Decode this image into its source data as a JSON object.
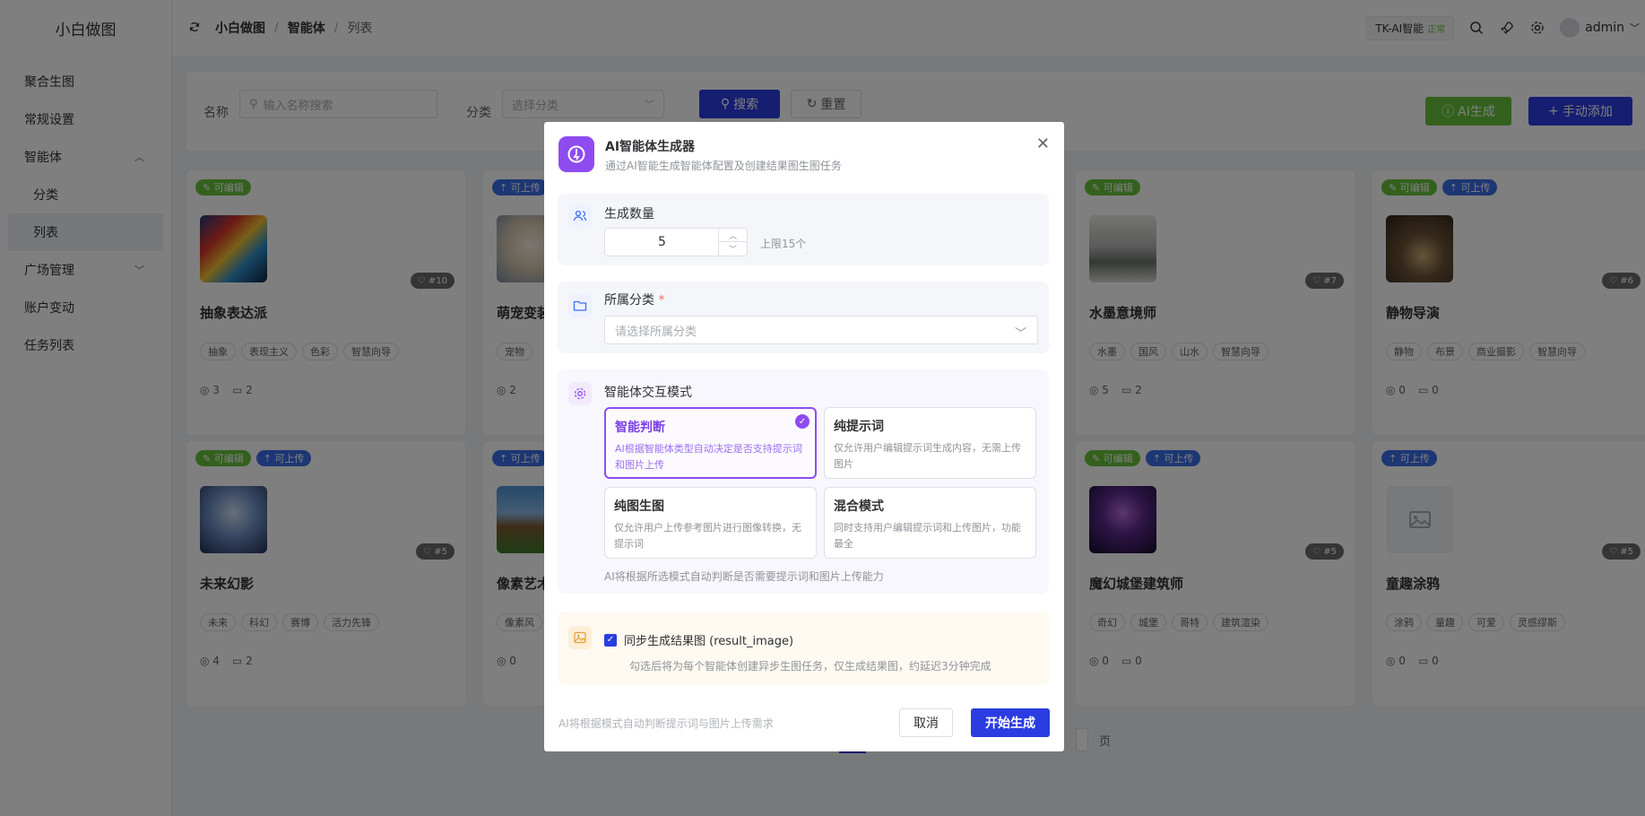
{
  "app": {
    "logo": "小白做图"
  },
  "sidebar": {
    "items": [
      {
        "label": "聚合生图"
      },
      {
        "label": "常规设置"
      },
      {
        "label": "智能体"
      },
      {
        "label": "分类"
      },
      {
        "label": "列表"
      },
      {
        "label": "广场管理"
      },
      {
        "label": "账户变动"
      },
      {
        "label": "任务列表"
      }
    ]
  },
  "header": {
    "breadcrumb": [
      "小白做图",
      "智能体",
      "列表"
    ],
    "badge_name": "TK-AI智能",
    "badge_status": "正常",
    "user": "admin"
  },
  "search": {
    "name_label": "名称",
    "name_placeholder": "输入名称搜索",
    "category_label": "分类",
    "category_placeholder": "选择分类",
    "search_btn": "搜索",
    "reset_btn": "重置",
    "ai_btn": "AI生成",
    "add_btn": "手动添加"
  },
  "cards": [
    {
      "editable": "可编辑",
      "title": "抽象表达派",
      "rank": "#10",
      "tags": [
        "抽象",
        "表现主义",
        "色彩",
        "智慧向导"
      ],
      "views": "3",
      "comments": "2",
      "thumb": "abstract"
    },
    {
      "upload": "可上传",
      "title": "萌宠变装",
      "rank": "",
      "tags": [
        "宠物"
      ],
      "views": "2",
      "comments": "",
      "thumb": "dog"
    },
    {
      "editable": "可编辑",
      "title": "水墨意境师",
      "rank": "#7",
      "tags": [
        "水墨",
        "国风",
        "山水",
        "智慧向导"
      ],
      "views": "5",
      "comments": "2",
      "thumb": "ink"
    },
    {
      "editable": "可编辑",
      "upload": "可上传",
      "title": "静物导演",
      "rank": "#6",
      "tags": [
        "静物",
        "布景",
        "商业摄影",
        "智慧向导"
      ],
      "views": "0",
      "comments": "0",
      "thumb": "still"
    },
    {
      "editable": "可编辑",
      "upload": "可上传",
      "title": "未来幻影",
      "rank": "#5",
      "tags": [
        "未来",
        "科幻",
        "赛博",
        "活力先锋"
      ],
      "views": "4",
      "comments": "2",
      "thumb": "future"
    },
    {
      "upload": "可上传",
      "title": "像素艺术",
      "rank": "",
      "tags": [
        "像素风"
      ],
      "views": "0",
      "comments": "",
      "thumb": "pixel"
    },
    {
      "editable": "可编辑",
      "upload": "可上传",
      "title": "魔幻城堡建筑师",
      "rank": "#5",
      "tags": [
        "奇幻",
        "城堡",
        "哥特",
        "建筑渲染"
      ],
      "views": "0",
      "comments": "0",
      "thumb": "castle"
    },
    {
      "upload": "可上传",
      "title": "童趣涂鸦",
      "rank": "#5",
      "tags": [
        "涂鸦",
        "童趣",
        "可爱",
        "灵感缪斯"
      ],
      "views": "0",
      "comments": "0",
      "thumb": "placeholder"
    }
  ],
  "pagination": {
    "suffix": "页"
  },
  "modal": {
    "title": "AI智能体生成器",
    "subtitle": "通过AI智能生成智能体配置及创建结果图生图任务",
    "count_label": "生成数量",
    "count_value": "5",
    "count_limit": "上限15个",
    "category_label": "所属分类",
    "category_required": "*",
    "category_placeholder": "请选择所属分类",
    "mode_label": "智能体交互模式",
    "modes": [
      {
        "title": "智能判断",
        "desc": "AI根据智能体类型自动决定是否支持提示词和图片上传",
        "selected": true
      },
      {
        "title": "纯提示词",
        "desc": "仅允许用户编辑提示词生成内容，无需上传图片",
        "selected": false
      },
      {
        "title": "纯图生图",
        "desc": "仅允许用户上传参考图片进行图像转换，无提示词",
        "selected": false
      },
      {
        "title": "混合模式",
        "desc": "同时支持用户编辑提示词和上传图片，功能最全",
        "selected": false
      }
    ],
    "mode_note": "AI将根据所选模式自动判断是否需要提示词和图片上传能力",
    "sync_label": "同步生成结果图 (result_image)",
    "sync_checked": true,
    "sync_note": "勾选后将为每个智能体创建异步生图任务，仅生成结果图，约延迟3分钟完成",
    "footer_note": "AI将根据模式自动判断提示词与图片上传需求",
    "cancel": "取消",
    "start": "开始生成"
  },
  "colors": {
    "primary": "#2b3de0",
    "green": "#67c23a",
    "purple": "#8e4cf0",
    "tag_blue": "#3b6fe8"
  }
}
